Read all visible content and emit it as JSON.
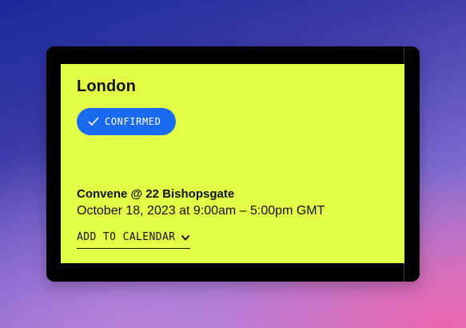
{
  "event": {
    "location": "London",
    "status_label": "CONFIRMED",
    "venue": "Convene @ 22 Bishopsgate",
    "datetime": "October 18, 2023 at 9:00am – 5:00pm GMT",
    "add_to_calendar_label": "ADD TO CALENDAR"
  },
  "icons": {
    "status": "checkmark-icon",
    "dropdown": "chevron-down-icon"
  },
  "colors": {
    "card_background": "#e3ff46",
    "badge_background": "#1a6af0",
    "frame": "#000000"
  }
}
